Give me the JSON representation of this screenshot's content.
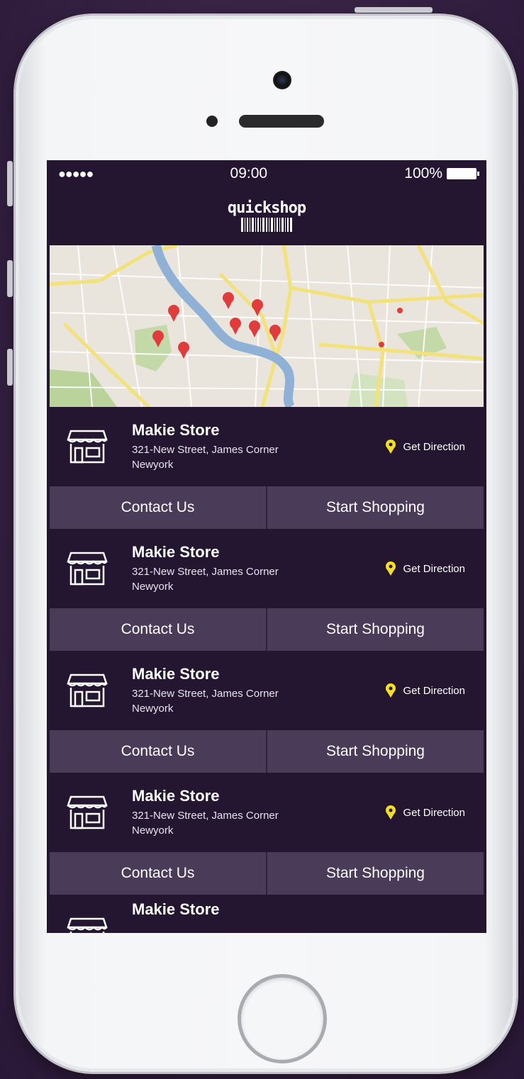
{
  "status_bar": {
    "signal": "●●●●●",
    "time": "09:00",
    "battery": "100%"
  },
  "app": {
    "logo": "quickshop"
  },
  "stores": [
    {
      "name": "Makie Store",
      "address_line1": "321-New Street, James Corner",
      "address_line2": "Newyork",
      "direction": "Get Direction",
      "contact": "Contact Us",
      "shop": "Start Shopping"
    },
    {
      "name": "Makie Store",
      "address_line1": "321-New Street, James Corner",
      "address_line2": "Newyork",
      "direction": "Get Direction",
      "contact": "Contact Us",
      "shop": "Start Shopping"
    },
    {
      "name": "Makie Store",
      "address_line1": "321-New Street, James Corner",
      "address_line2": "Newyork",
      "direction": "Get Direction",
      "contact": "Contact Us",
      "shop": "Start Shopping"
    },
    {
      "name": "Makie Store",
      "address_line1": "321-New Street, James Corner",
      "address_line2": "Newyork",
      "direction": "Get Direction",
      "contact": "Contact Us",
      "shop": "Start Shopping"
    },
    {
      "name": "Makie Store"
    }
  ],
  "colors": {
    "background": "#241631",
    "button": "#4a3b58",
    "pin": "#e23b3b",
    "direction_pin": "#f4e11b"
  },
  "icons": {
    "store": "store-icon",
    "direction": "location-pin-icon",
    "map_marker": "map-marker-icon"
  }
}
